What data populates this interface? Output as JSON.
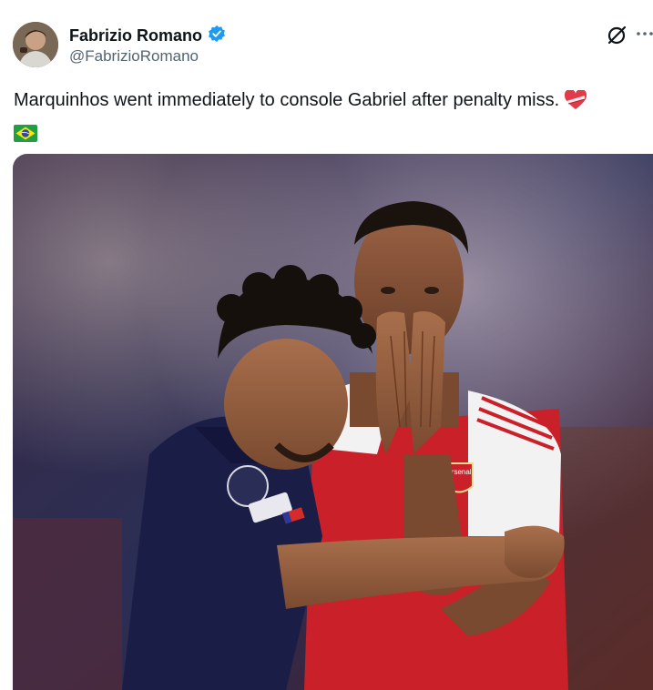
{
  "author": {
    "display_name": "Fabrizio Romano",
    "handle": "@FabrizioRomano",
    "verified": true
  },
  "tweet": {
    "text": "Marquinhos went immediately to console Gabriel after penalty miss.",
    "emojis": [
      "heart-with-ribbon",
      "flag-brazil"
    ]
  },
  "media": {
    "subjects": [
      "player-navy-kit",
      "player-red-white-kit"
    ],
    "shirt_text": "Arsenal"
  },
  "colors": {
    "verified_blue": "#1d9bf0",
    "text_primary": "#0f1419",
    "text_secondary": "#536471",
    "navy_kit": "#1a1d45",
    "red_kit": "#d52b2b"
  }
}
